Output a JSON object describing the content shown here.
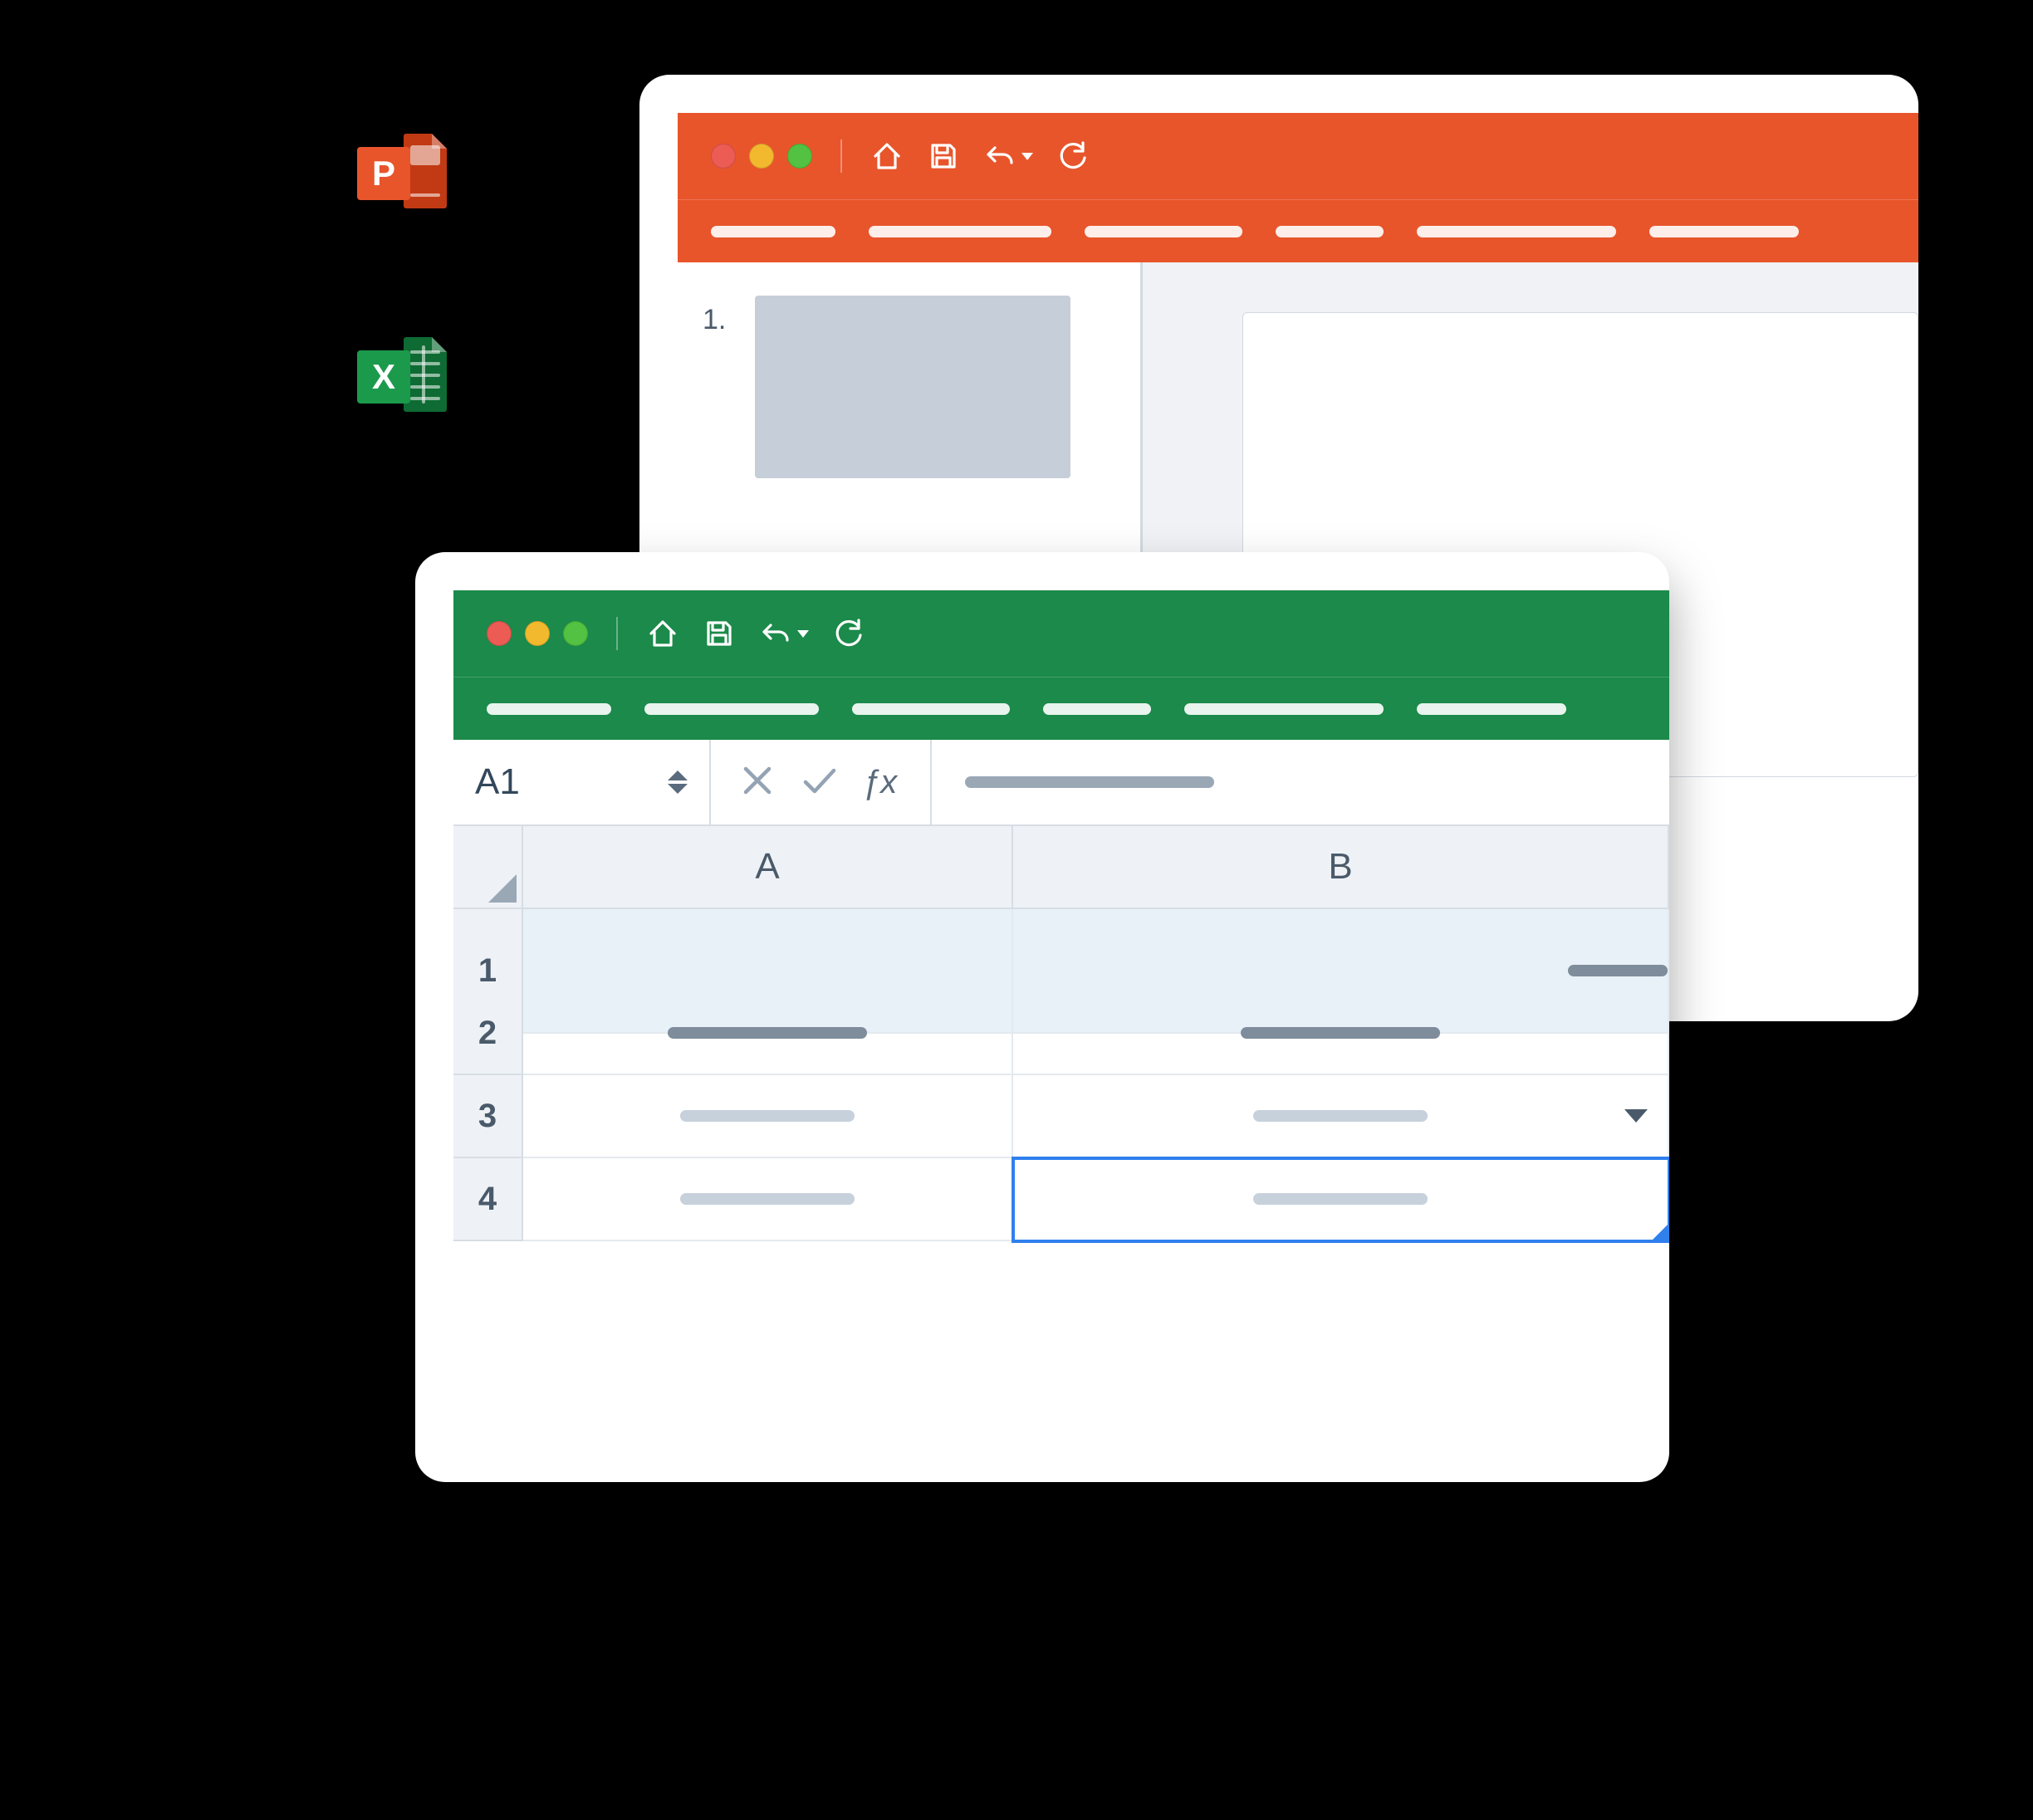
{
  "icons": {
    "powerpoint_letter": "P",
    "excel_letter": "X"
  },
  "powerpoint_window": {
    "accent": "#e8552b",
    "toolbar": {
      "home_icon": "home",
      "save_icon": "save",
      "undo_icon": "undo",
      "refresh_icon": "refresh"
    },
    "slide_panel": {
      "slides": [
        {
          "index_label": "1."
        }
      ]
    }
  },
  "excel_window": {
    "accent": "#1b8a4a",
    "toolbar": {
      "home_icon": "home",
      "save_icon": "save",
      "undo_icon": "undo",
      "refresh_icon": "refresh"
    },
    "formula_bar": {
      "name_box": "A1",
      "cancel_icon": "cancel",
      "accept_icon": "accept",
      "fx_label": "ƒx"
    },
    "grid": {
      "columns": [
        "A",
        "B"
      ],
      "rows": [
        "1",
        "2",
        "3",
        "4"
      ],
      "active_cell": "B4"
    }
  }
}
